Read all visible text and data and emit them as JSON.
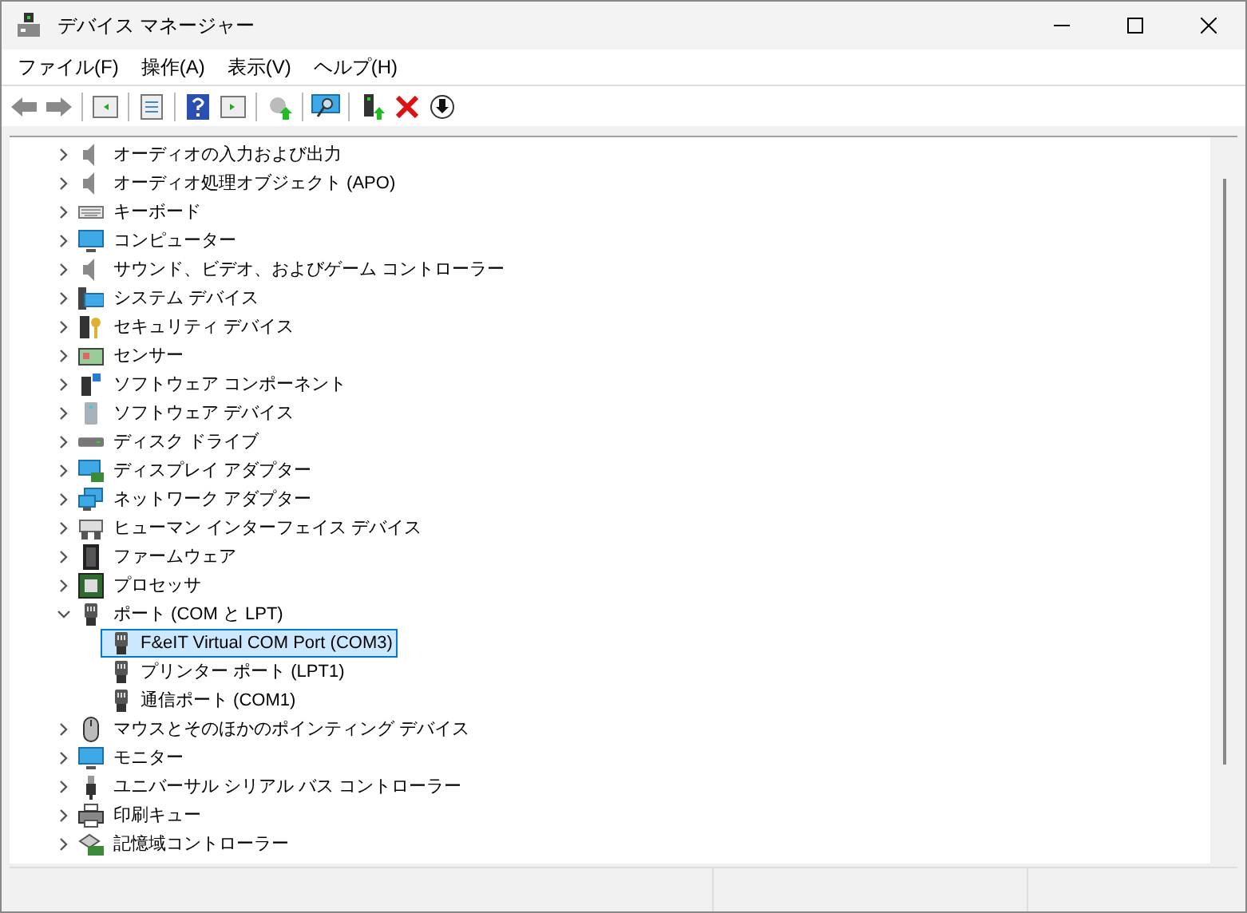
{
  "window": {
    "title": "デバイス マネージャー"
  },
  "menu": [
    "ファイル(F)",
    "操作(A)",
    "表示(V)",
    "ヘルプ(H)"
  ],
  "tree": [
    {
      "label": "オーディオの入力および出力",
      "expanded": false
    },
    {
      "label": "オーディオ処理オブジェクト (APO)",
      "expanded": false
    },
    {
      "label": "キーボード",
      "expanded": false
    },
    {
      "label": "コンピューター",
      "expanded": false
    },
    {
      "label": "サウンド、ビデオ、およびゲーム コントローラー",
      "expanded": false
    },
    {
      "label": "システム デバイス",
      "expanded": false
    },
    {
      "label": "セキュリティ デバイス",
      "expanded": false
    },
    {
      "label": "センサー",
      "expanded": false
    },
    {
      "label": "ソフトウェア コンポーネント",
      "expanded": false
    },
    {
      "label": "ソフトウェア デバイス",
      "expanded": false
    },
    {
      "label": "ディスク ドライブ",
      "expanded": false
    },
    {
      "label": "ディスプレイ アダプター",
      "expanded": false
    },
    {
      "label": "ネットワーク アダプター",
      "expanded": false
    },
    {
      "label": "ヒューマン インターフェイス デバイス",
      "expanded": false
    },
    {
      "label": "ファームウェア",
      "expanded": false
    },
    {
      "label": "プロセッサ",
      "expanded": false
    },
    {
      "label": "ポート (COM と LPT)",
      "expanded": true,
      "children": [
        {
          "label": "F&eIT Virtual COM Port (COM3)",
          "selected": true
        },
        {
          "label": "プリンター ポート (LPT1)",
          "selected": false
        },
        {
          "label": "通信ポート (COM1)",
          "selected": false
        }
      ]
    },
    {
      "label": "マウスとそのほかのポインティング デバイス",
      "expanded": false
    },
    {
      "label": "モニター",
      "expanded": false
    },
    {
      "label": "ユニバーサル シリアル バス コントローラー",
      "expanded": false
    },
    {
      "label": "印刷キュー",
      "expanded": false
    },
    {
      "label": "記憶域コントローラー",
      "expanded": false
    }
  ]
}
